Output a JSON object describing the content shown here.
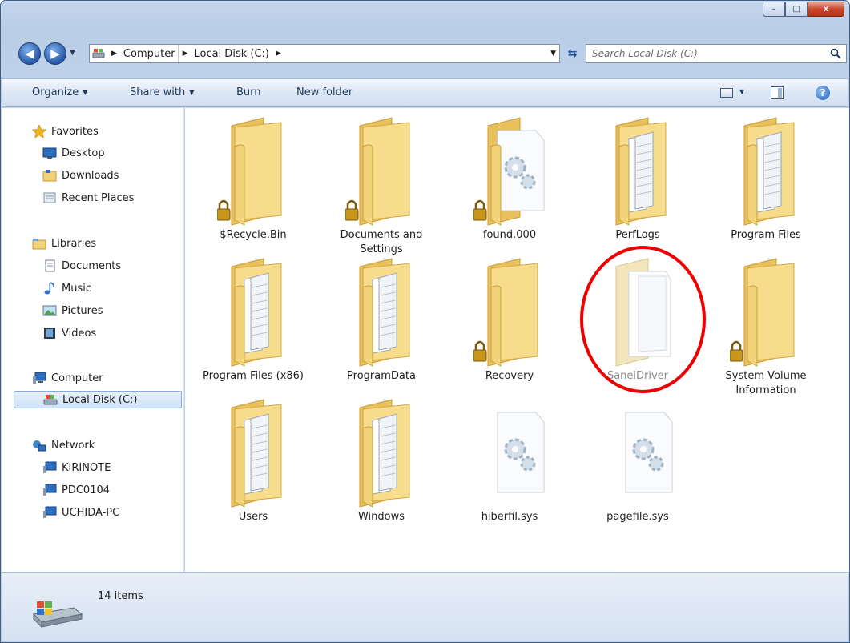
{
  "window": {
    "buttons": {
      "minimize": "–",
      "maximize": "□",
      "close": "x"
    }
  },
  "address": {
    "crumbs": [
      "Computer",
      "Local Disk (C:)"
    ],
    "search_placeholder": "Search Local Disk (C:)"
  },
  "toolbar": {
    "organize": "Organize",
    "share_with": "Share with",
    "burn": "Burn",
    "new_folder": "New folder"
  },
  "sidebar": {
    "favorites": {
      "label": "Favorites",
      "items": [
        "Desktop",
        "Downloads",
        "Recent Places"
      ]
    },
    "libraries": {
      "label": "Libraries",
      "items": [
        "Documents",
        "Music",
        "Pictures",
        "Videos"
      ]
    },
    "computer": {
      "label": "Computer",
      "items": [
        "Local Disk (C:)"
      ]
    },
    "network": {
      "label": "Network",
      "items": [
        "KIRINOTE",
        "PDC0104",
        "UCHIDA-PC"
      ]
    }
  },
  "files": [
    {
      "name": "$Recycle.Bin",
      "icon": "folder-locked-icon"
    },
    {
      "name": "Documents and Settings",
      "icon": "folder-locked-icon"
    },
    {
      "name": "found.000",
      "icon": "folder-locked-gear-icon"
    },
    {
      "name": "PerfLogs",
      "icon": "folder-docs-icon"
    },
    {
      "name": "Program Files",
      "icon": "folder-docs-icon"
    },
    {
      "name": "Program Files (x86)",
      "icon": "folder-docs-icon"
    },
    {
      "name": "ProgramData",
      "icon": "folder-docs-icon"
    },
    {
      "name": "Recovery",
      "icon": "folder-locked-icon"
    },
    {
      "name": "SaneiDriver",
      "icon": "folder-hidden-icon"
    },
    {
      "name": "System Volume Information",
      "icon": "folder-locked-icon"
    },
    {
      "name": "Users",
      "icon": "folder-docs-icon"
    },
    {
      "name": "Windows",
      "icon": "folder-docs-icon"
    },
    {
      "name": "hiberfil.sys",
      "icon": "system-file-icon"
    },
    {
      "name": "pagefile.sys",
      "icon": "system-file-icon"
    }
  ],
  "status": {
    "item_count": "14 items"
  },
  "colors": {
    "highlight_ring": "#e00000",
    "folder": "#f4d27a",
    "accent": "#1e395b"
  }
}
